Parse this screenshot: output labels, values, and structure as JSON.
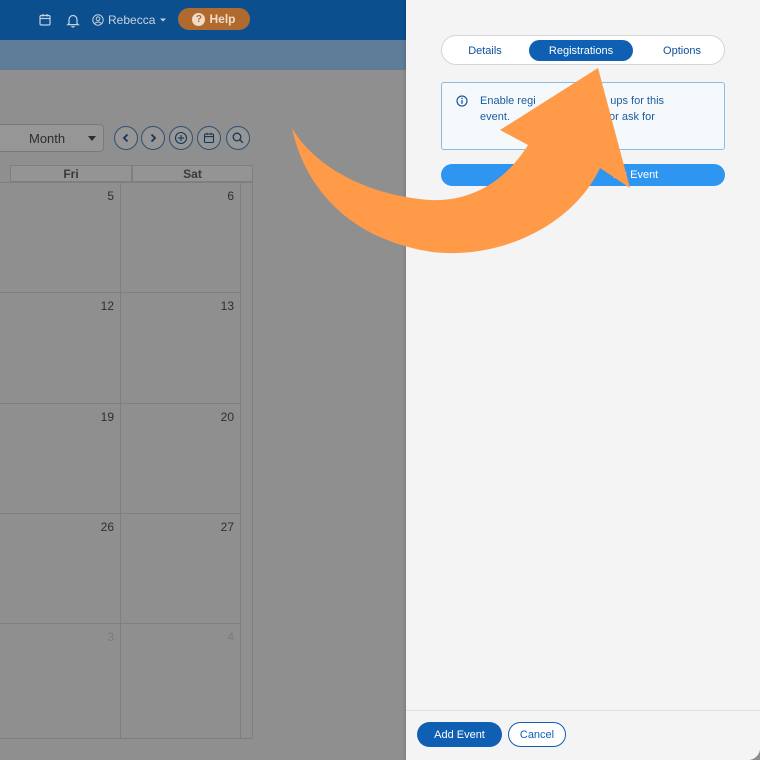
{
  "topbar": {
    "user_name": "Rebecca",
    "help_label": "Help",
    "help_icon_text": "?",
    "icons": [
      "calendar-icon",
      "bell-icon",
      "user-circle-icon",
      "caret-down-icon"
    ]
  },
  "calendar": {
    "view_select_value": "Month",
    "toolbar_icons": [
      "chevron-left-icon",
      "chevron-right-icon",
      "plus-circle-icon",
      "calendar-icon",
      "search-icon"
    ],
    "headers": [
      "Fri",
      "Sat"
    ],
    "rows": [
      [
        "5",
        "6"
      ],
      [
        "12",
        "13"
      ],
      [
        "19",
        "20"
      ],
      [
        "26",
        "27"
      ],
      [
        "3",
        "4"
      ]
    ]
  },
  "panel": {
    "tabs": [
      {
        "label": "Details",
        "active": false
      },
      {
        "label": "Registrations",
        "active": true
      },
      {
        "label": "Options",
        "active": false
      }
    ],
    "info_line1": "Enable regi              y sign ups for this",
    "info_line2": "event.               questions, or ask for",
    "setup_button_label": "S           ation f      his Event",
    "add_event_label": "Add Event",
    "cancel_label": "Cancel"
  },
  "colors": {
    "nav_blue": "#0c4f8f",
    "primary_blue": "#0f5fb3",
    "setup_blue": "#2e95f1",
    "arrow_orange": "#ff9a48",
    "help_orange": "#b06a2f"
  }
}
